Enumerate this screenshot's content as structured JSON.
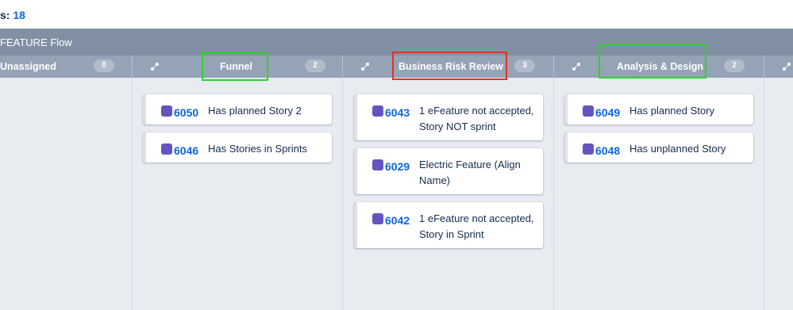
{
  "header": {
    "count_label": "s:",
    "count_value": "18"
  },
  "flow": {
    "title": "FEATURE Flow"
  },
  "columns": [
    {
      "title": "Unassigned",
      "count": "0"
    },
    {
      "title": "Funnel",
      "count": "2"
    },
    {
      "title": "Business Risk Review",
      "count": "3"
    },
    {
      "title": "Analysis & Design",
      "count": "2"
    }
  ],
  "cards": {
    "funnel": [
      {
        "id": "6050",
        "summary": "Has planned Story 2"
      },
      {
        "id": "6046",
        "summary": "Has Stories in Sprints"
      }
    ],
    "business_risk_review": [
      {
        "id": "6043",
        "summary": "1 eFeature not accepted, Story NOT sprint"
      },
      {
        "id": "6029",
        "summary": "Electric Feature (Align Name)"
      },
      {
        "id": "6042",
        "summary": "1 eFeature not accepted, Story in Sprint"
      }
    ],
    "analysis_design": [
      {
        "id": "6049",
        "summary": "Has planned Story"
      },
      {
        "id": "6048",
        "summary": "Has unplanned Story"
      }
    ]
  },
  "icons": {
    "collapse": "collapse-arrows-icon",
    "issue_type": "feature-lightning-icon"
  },
  "colors": {
    "highlight_green": "#2bd42b",
    "highlight_red": "#e53222",
    "issue_id": "#0c66e4",
    "header_bar": "#8290a4",
    "column_header": "#95a3b6"
  }
}
